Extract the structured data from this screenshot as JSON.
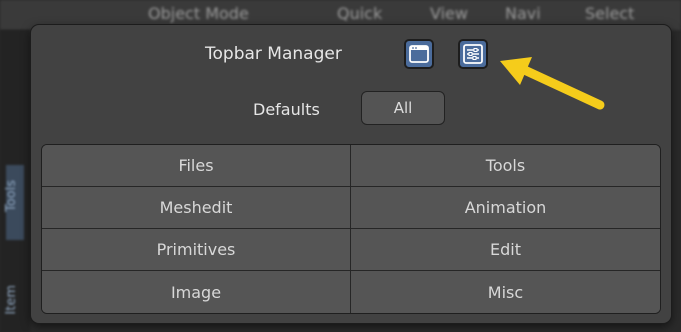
{
  "background": {
    "header_texts": [
      "Object Mode",
      "Quick",
      "View",
      "Navi",
      "Select"
    ],
    "sidebar_texts": [
      "Tools",
      "Item"
    ]
  },
  "popup": {
    "title": "Topbar Manager",
    "defaults_label": "Defaults",
    "all_button": "All",
    "icon_buttons": [
      "window-icon",
      "settings-icon"
    ],
    "categories": [
      [
        "Files",
        "Tools"
      ],
      [
        "Meshedit",
        "Animation"
      ],
      [
        "Primitives",
        "Edit"
      ],
      [
        "Image",
        "Misc"
      ]
    ]
  },
  "annotation": {
    "arrow_color": "#f5cc1b"
  },
  "colors": {
    "icon_button": "#4b6c9c",
    "panel": "#424242",
    "cell": "#555555"
  }
}
